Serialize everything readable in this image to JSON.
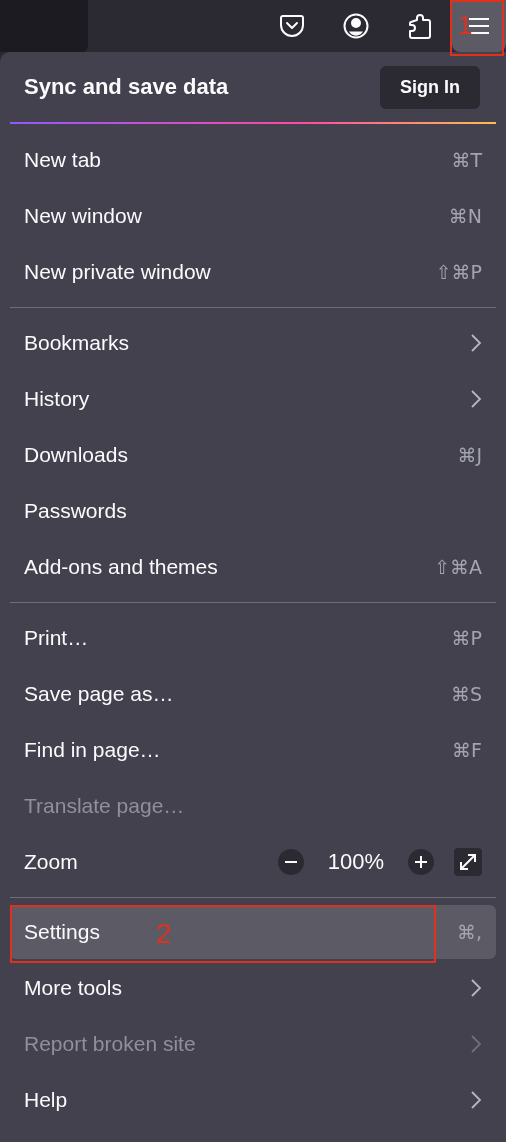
{
  "toolbar": {
    "buttons": [
      {
        "kind": "pocket",
        "selected": false
      },
      {
        "kind": "account",
        "selected": false
      },
      {
        "kind": "extensions",
        "selected": false
      },
      {
        "kind": "menu",
        "selected": true,
        "annotation": "1"
      }
    ]
  },
  "menu": {
    "header": {
      "title": "Sync and save data",
      "button": "Sign In"
    },
    "sections": [
      {
        "items": [
          {
            "kind": "shortcut",
            "label": "New tab",
            "shortcut": "⌘T",
            "disabled": false,
            "selected": false
          },
          {
            "kind": "shortcut",
            "label": "New window",
            "shortcut": "⌘N",
            "disabled": false,
            "selected": false
          },
          {
            "kind": "shortcut",
            "label": "New private window",
            "shortcut": "⇧⌘P",
            "disabled": false,
            "selected": false
          }
        ]
      },
      {
        "items": [
          {
            "kind": "submenu",
            "label": "Bookmarks",
            "disabled": false,
            "selected": false
          },
          {
            "kind": "submenu",
            "label": "History",
            "disabled": false,
            "selected": false
          },
          {
            "kind": "shortcut",
            "label": "Downloads",
            "shortcut": "⌘J",
            "disabled": false,
            "selected": false
          },
          {
            "kind": "plain",
            "label": "Passwords",
            "disabled": false,
            "selected": false
          },
          {
            "kind": "shortcut",
            "label": "Add-ons and themes",
            "shortcut": "⇧⌘A",
            "disabled": false,
            "selected": false
          }
        ]
      },
      {
        "items": [
          {
            "kind": "shortcut",
            "label": "Print…",
            "shortcut": "⌘P",
            "disabled": false,
            "selected": false
          },
          {
            "kind": "shortcut",
            "label": "Save page as…",
            "shortcut": "⌘S",
            "disabled": false,
            "selected": false
          },
          {
            "kind": "shortcut",
            "label": "Find in page…",
            "shortcut": "⌘F",
            "disabled": false,
            "selected": false
          },
          {
            "kind": "plain",
            "label": "Translate page…",
            "disabled": true,
            "selected": false
          },
          {
            "kind": "zoom",
            "label": "Zoom",
            "value": "100%",
            "disabled": false
          }
        ]
      },
      {
        "items": [
          {
            "kind": "shortcut",
            "label": "Settings",
            "shortcut": "⌘,",
            "disabled": false,
            "selected": true,
            "annotation": "2"
          },
          {
            "kind": "submenu",
            "label": "More tools",
            "disabled": false,
            "selected": false
          },
          {
            "kind": "submenu",
            "label": "Report broken site",
            "disabled": true,
            "selected": false
          },
          {
            "kind": "submenu",
            "label": "Help",
            "disabled": false,
            "selected": false
          }
        ]
      }
    ]
  }
}
